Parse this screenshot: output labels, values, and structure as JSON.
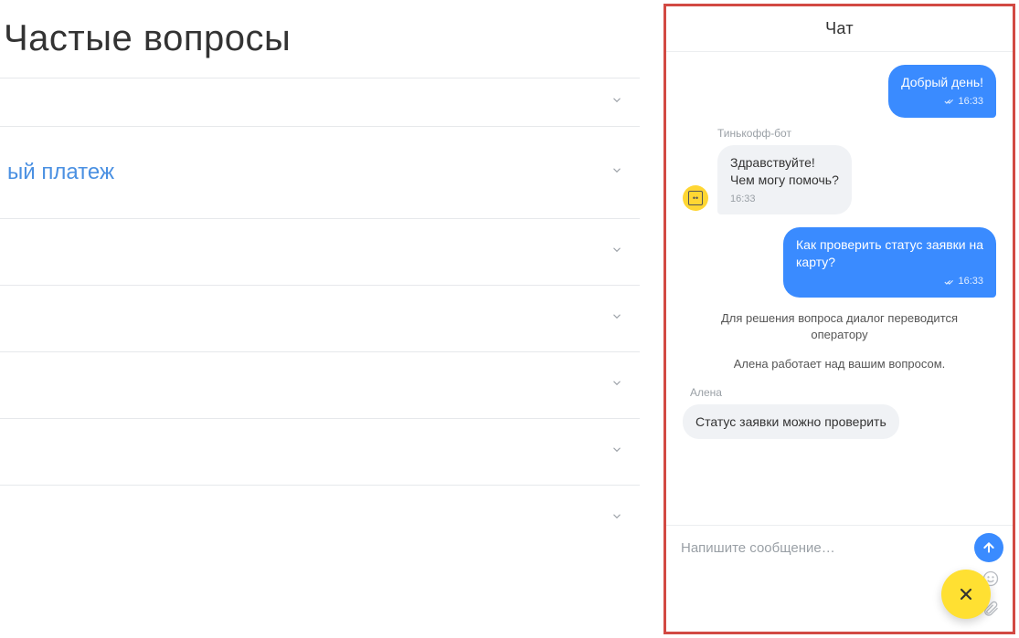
{
  "page": {
    "title": "Частые вопросы"
  },
  "faq": {
    "items": [
      {
        "label": ""
      },
      {
        "label": "ый платеж"
      },
      {
        "label": ""
      },
      {
        "label": ""
      },
      {
        "label": ""
      },
      {
        "label": ""
      },
      {
        "label": ""
      }
    ]
  },
  "chat": {
    "title": "Чат",
    "bot_name": "Тинькофф-бот",
    "operator_name": "Алена",
    "messages": {
      "m1": {
        "text": "Добрый день!",
        "time": "16:33"
      },
      "m2": {
        "text_l1": "Здравствуйте!",
        "text_l2": "Чем могу помочь?",
        "time": "16:33"
      },
      "m3": {
        "text_l1": "Как проверить статус заявки на",
        "text_l2": "карту?",
        "time": "16:33"
      },
      "sys1": "Для решения вопроса диалог переводится оператору",
      "sys2": "Алена работает над вашим вопросом.",
      "m4": {
        "text": "Статус заявки можно проверить"
      }
    },
    "input_placeholder": "Напишите сообщение…"
  }
}
